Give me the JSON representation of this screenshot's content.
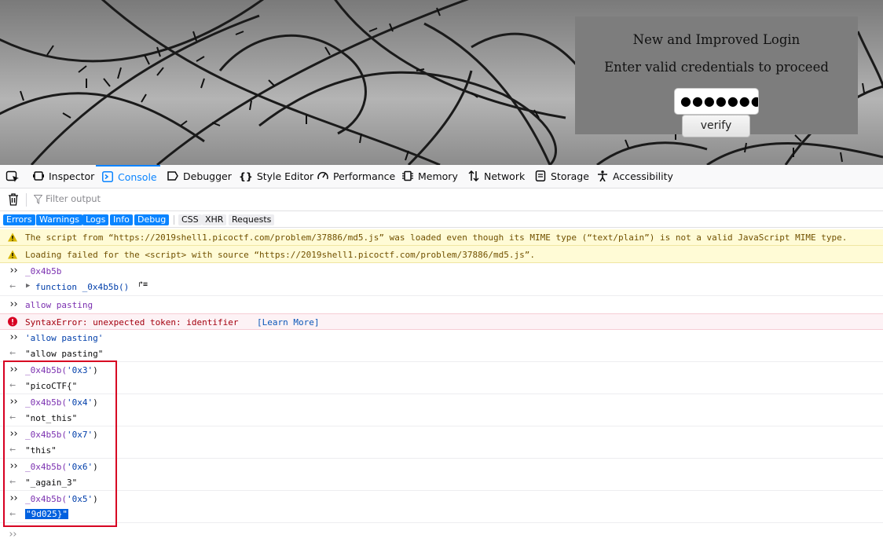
{
  "page": {
    "login_title": "New and Improved Login",
    "login_subtitle": "Enter valid credentials to proceed",
    "password_value": "●●●●●●●●●●",
    "verify_label": "verify"
  },
  "devtools": {
    "tabs": [
      {
        "label": "Inspector",
        "icon": "inspector-icon"
      },
      {
        "label": "Console",
        "icon": "console-icon",
        "active": true
      },
      {
        "label": "Debugger",
        "icon": "debugger-icon"
      },
      {
        "label": "Style Editor",
        "icon": "style-editor-icon"
      },
      {
        "label": "Performance",
        "icon": "performance-icon"
      },
      {
        "label": "Memory",
        "icon": "memory-icon"
      },
      {
        "label": "Network",
        "icon": "network-icon"
      },
      {
        "label": "Storage",
        "icon": "storage-icon"
      },
      {
        "label": "Accessibility",
        "icon": "accessibility-icon"
      }
    ],
    "filter_placeholder": "Filter output",
    "categories": {
      "errors": "Errors",
      "warnings": "Warnings",
      "logs": "Logs",
      "info": "Info",
      "debug": "Debug",
      "css": "CSS",
      "xhr": "XHR",
      "requests": "Requests"
    },
    "accent_color": "#0a84ff",
    "console": [
      {
        "kind": "warning",
        "text": "The script from “https://2019shell1.picoctf.com/problem/37886/md5.js” was loaded even though its MIME type (“text/plain”) is not a valid JavaScript MIME type."
      },
      {
        "kind": "warning",
        "text": "Loading failed for the <script> with source “https://2019shell1.picoctf.com/problem/37886/md5.js”."
      },
      {
        "kind": "input",
        "text": "_0x4b5b"
      },
      {
        "kind": "output",
        "text": "function _0x4b5b()"
      },
      {
        "kind": "input",
        "text": "allow pasting"
      },
      {
        "kind": "error",
        "text": "SyntaxError: unexpected token: identifier",
        "link": "[Learn More]"
      },
      {
        "kind": "input",
        "text": "'allow pasting'"
      },
      {
        "kind": "output",
        "text": "\"allow pasting\""
      },
      {
        "kind": "input",
        "fn": "_0x4b5b(",
        "arg": "'0x3'",
        "close": ")"
      },
      {
        "kind": "output",
        "text": "\"picoCTF{\""
      },
      {
        "kind": "input",
        "fn": "_0x4b5b(",
        "arg": "'0x4'",
        "close": ")"
      },
      {
        "kind": "output",
        "text": "\"not_this\""
      },
      {
        "kind": "input",
        "fn": "_0x4b5b(",
        "arg": "'0x7'",
        "close": ")"
      },
      {
        "kind": "output",
        "text": "\"this\""
      },
      {
        "kind": "input",
        "fn": "_0x4b5b(",
        "arg": "'0x6'",
        "close": ")"
      },
      {
        "kind": "output",
        "text": "\"_again_3\""
      },
      {
        "kind": "input",
        "fn": "_0x4b5b(",
        "arg": "'0x5'",
        "close": ")"
      },
      {
        "kind": "output",
        "text": "\"9d025}\"",
        "selected": true
      }
    ]
  }
}
